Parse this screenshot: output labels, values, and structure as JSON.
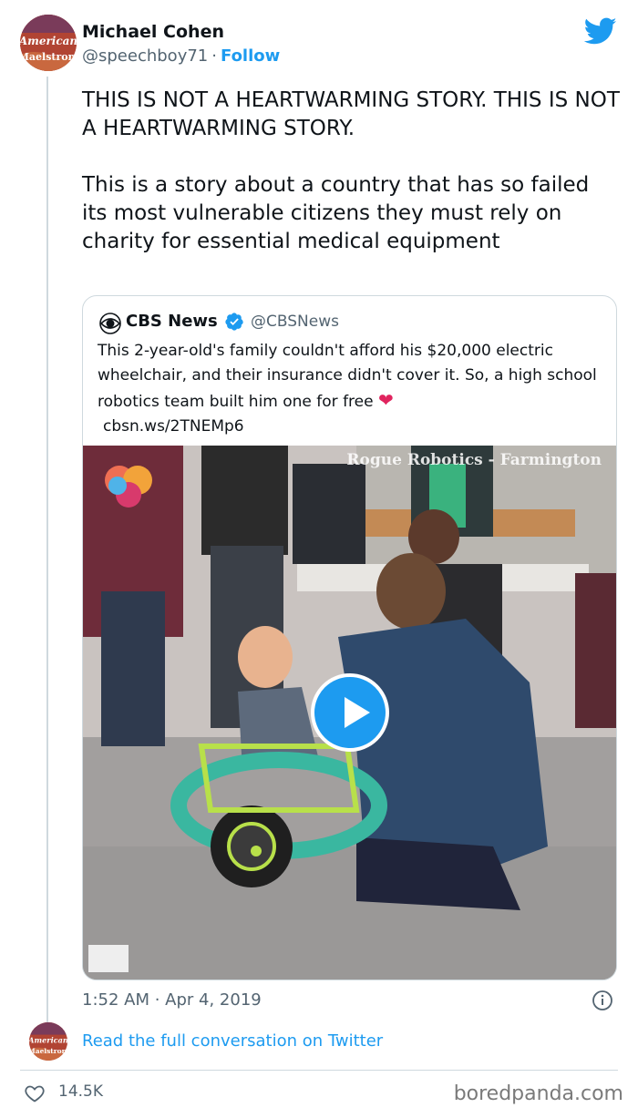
{
  "author": {
    "name": "Michael Cohen",
    "handle": "@speechboy71",
    "separator": "·",
    "follow_label": "Follow",
    "avatar_text_top": "American",
    "avatar_text_bottom": "Maelstrom"
  },
  "tweet": {
    "text": "THIS IS NOT A HEARTWARMING STORY. THIS IS NOT A HEARTWARMING STORY.\n\nThis is a story about a country that has so failed its most vulnerable citizens they must rely on charity for essential medical equipment",
    "timestamp": "1:52 AM · Apr 4, 2019"
  },
  "quoted": {
    "name": "CBS News",
    "handle": "@CBSNews",
    "text": "This 2-year-old's family couldn't afford his $20,000 electric wheelchair, and their insurance didn't cover it. So, a high school robotics team built him one for free",
    "heart": "❤",
    "link": "cbsn.ws/2TNEMp6",
    "media_watermark": "Rogue Robotics - Farmington"
  },
  "footer": {
    "read_conversation": "Read the full conversation on Twitter",
    "likes": "14.5K",
    "source": "boredpanda.com"
  },
  "icons": {
    "twitter": "twitter-bird-icon",
    "verified": "verified-badge-icon",
    "info": "info-icon",
    "like": "heart-outline-icon",
    "play": "play-icon"
  },
  "colors": {
    "accent": "#1d9bf0",
    "text": "#0f1419",
    "muted": "#536471",
    "border": "#cfd9de"
  }
}
